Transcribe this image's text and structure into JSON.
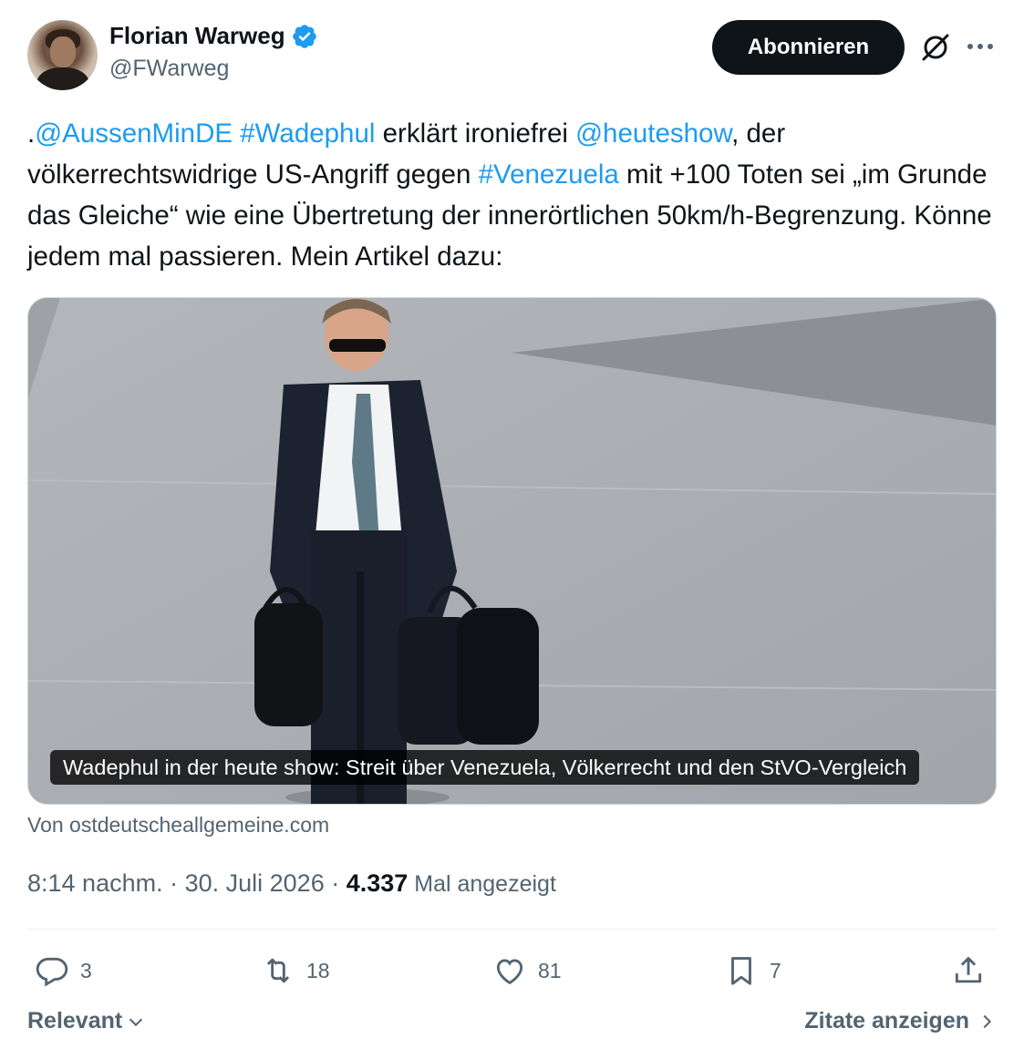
{
  "author": {
    "display_name": "Florian Warweg",
    "handle": "@FWarweg",
    "verified": true
  },
  "header": {
    "follow_label": "Abonnieren",
    "grok_icon": "grok-icon",
    "more_icon": "more-icon"
  },
  "tweet": {
    "segments": [
      {
        "text": ".",
        "type": "text"
      },
      {
        "text": "@AussenMinDE",
        "type": "link"
      },
      {
        "text": " ",
        "type": "text"
      },
      {
        "text": "#Wadephul",
        "type": "link"
      },
      {
        "text": " erklärt ironiefrei ",
        "type": "text"
      },
      {
        "text": "@heuteshow",
        "type": "link"
      },
      {
        "text": ", der völkerrechtswidrige US-Angriff gegen ",
        "type": "text"
      },
      {
        "text": "#Venezuela",
        "type": "link"
      },
      {
        "text": " mit +100 Toten sei „im Grunde das Gleiche“ wie eine Übertretung der innerörtlichen 50km/h-Begrenzung. Könne jedem mal passieren. Mein Artikel dazu:",
        "type": "text"
      }
    ]
  },
  "card": {
    "caption": "Wadephul in der heute show: Streit über Venezuela, Völkerrecht und den StVO-Vergleich",
    "source": "Von ostdeutscheallgemeine.com"
  },
  "meta": {
    "time": "8:14 nachm.",
    "separator1": " · ",
    "date": "30. Juli 2026",
    "separator2": " · ",
    "views": "4.337",
    "views_label": " Mal angezeigt"
  },
  "actions": {
    "replies": "3",
    "reposts": "18",
    "likes": "81",
    "bookmarks": "7"
  },
  "footer": {
    "sort_label": "Relevant",
    "quotes_label": "Zitate anzeigen"
  },
  "colors": {
    "link": "#1d9bf0",
    "verified": "#1d9bf0",
    "muted": "#536471",
    "text": "#0f1419"
  }
}
